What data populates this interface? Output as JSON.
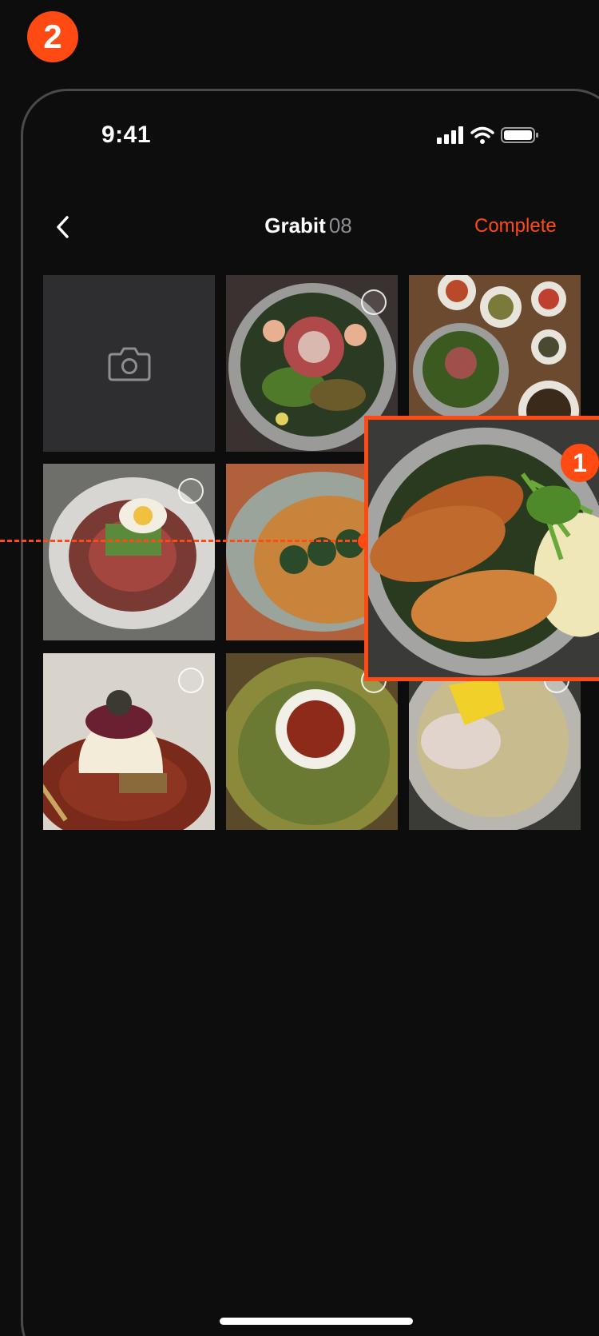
{
  "annotation": {
    "step_number": "2",
    "callout_number": "1",
    "accent": "#ff4a14"
  },
  "status_bar": {
    "time": "9:41"
  },
  "nav": {
    "title": "Grabit",
    "count": "08",
    "complete_label": "Complete"
  },
  "gallery": {
    "tiles": [
      {
        "kind": "camera",
        "icon": "camera-icon"
      },
      {
        "kind": "photo",
        "subject": "octopus-bowl"
      },
      {
        "kind": "photo",
        "subject": "table-banchan"
      },
      {
        "kind": "photo",
        "subject": "naengmyeon-egg"
      },
      {
        "kind": "photo",
        "subject": "risotto-plate"
      },
      {
        "kind": "photo",
        "subject": "fish-rice-bowl"
      },
      {
        "kind": "photo",
        "subject": "bingsu-dessert"
      },
      {
        "kind": "photo",
        "subject": "pancake-dip"
      },
      {
        "kind": "photo",
        "subject": "noodle-soup"
      }
    ]
  }
}
